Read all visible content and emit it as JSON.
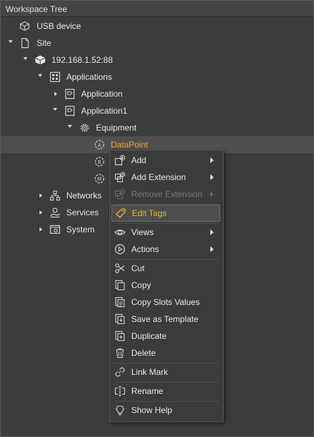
{
  "panel": {
    "title": "Workspace Tree"
  },
  "tree": {
    "usb_device": "USB device",
    "site": "Site",
    "ip": "192.168.1.52:88",
    "applications": "Applications",
    "application": "Application",
    "application1": "Application1",
    "equipment": "Equipment",
    "datapoint": "DataPoint",
    "networks": "Networks",
    "services": "Services",
    "system": "System"
  },
  "menu": {
    "add": "Add",
    "add_extension": "Add Extension",
    "remove_extension": "Remove Extension",
    "edit_tags": "Edit Tags",
    "views": "Views",
    "actions": "Actions",
    "cut": "Cut",
    "copy": "Copy",
    "copy_slots_values": "Copy Slots Values",
    "save_as_template": "Save as Template",
    "duplicate": "Duplicate",
    "delete": "Delete",
    "link_mark": "Link Mark",
    "rename": "Rename",
    "show_help": "Show Help"
  },
  "colors": {
    "accent": "#f0a830",
    "background": "#3c3c3c",
    "selected_row": "#4f4f4f"
  }
}
